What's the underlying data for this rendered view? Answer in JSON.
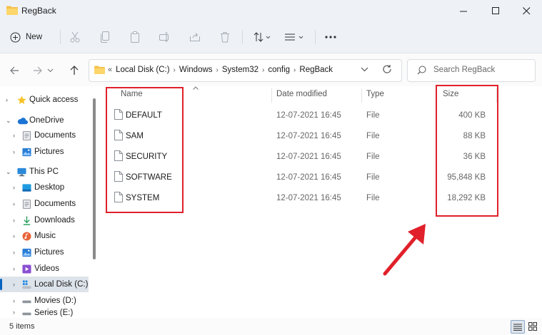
{
  "window": {
    "title": "RegBack"
  },
  "toolbar": {
    "new_label": "New"
  },
  "address": {
    "crumbs": [
      "Local Disk (C:)",
      "Windows",
      "System32",
      "config",
      "RegBack"
    ]
  },
  "search": {
    "placeholder": "Search RegBack"
  },
  "sidebar": {
    "items": [
      {
        "label": "Quick access",
        "icon": "star-icon"
      },
      {
        "label": "OneDrive",
        "icon": "cloud-icon"
      },
      {
        "label": "Documents",
        "icon": "documents-icon"
      },
      {
        "label": "Pictures",
        "icon": "pictures-icon"
      },
      {
        "label": "This PC",
        "icon": "computer-icon"
      },
      {
        "label": "Desktop",
        "icon": "desktop-icon"
      },
      {
        "label": "Documents",
        "icon": "documents-icon"
      },
      {
        "label": "Downloads",
        "icon": "download-icon"
      },
      {
        "label": "Music",
        "icon": "music-icon"
      },
      {
        "label": "Pictures",
        "icon": "pictures-icon"
      },
      {
        "label": "Videos",
        "icon": "videos-icon"
      },
      {
        "label": "Local Disk (C:)",
        "icon": "drive-icon",
        "selected": true
      },
      {
        "label": "Movies (D:)",
        "icon": "drive-icon"
      },
      {
        "label": "Series (E:)",
        "icon": "drive-icon"
      }
    ]
  },
  "columns": {
    "name": "Name",
    "date": "Date modified",
    "type": "Type",
    "size": "Size"
  },
  "files": [
    {
      "name": "DEFAULT",
      "date": "12-07-2021 16:45",
      "type": "File",
      "size": "400 KB"
    },
    {
      "name": "SAM",
      "date": "12-07-2021 16:45",
      "type": "File",
      "size": "88 KB"
    },
    {
      "name": "SECURITY",
      "date": "12-07-2021 16:45",
      "type": "File",
      "size": "36 KB"
    },
    {
      "name": "SOFTWARE",
      "date": "12-07-2021 16:45",
      "type": "File",
      "size": "95,848 KB"
    },
    {
      "name": "SYSTEM",
      "date": "12-07-2021 16:45",
      "type": "File",
      "size": "18,292 KB"
    }
  ],
  "status": {
    "count": "5 items"
  },
  "annotation_color": "#e0202a"
}
